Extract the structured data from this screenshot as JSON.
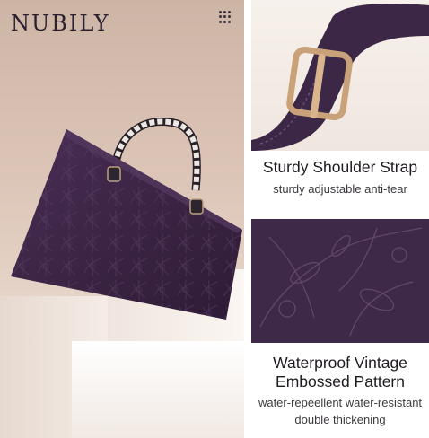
{
  "brand": {
    "logo_text": "NUBILY"
  },
  "header": {
    "menu_icon": "grid-dots-icon"
  },
  "features": [
    {
      "title": "Sturdy Shoulder Strap",
      "subtitle": "sturdy adjustable anti-tear"
    },
    {
      "title_line1": "Waterproof Vintage",
      "title_line2": "Embossed Pattern",
      "subtitle_line1": "water-repeellent water-resistant",
      "subtitle_line2": "double thickening"
    }
  ],
  "colors": {
    "bag_purple": "#3d2746",
    "buckle_gold": "#c9a27a",
    "background_beige": "#d8c2b4"
  }
}
